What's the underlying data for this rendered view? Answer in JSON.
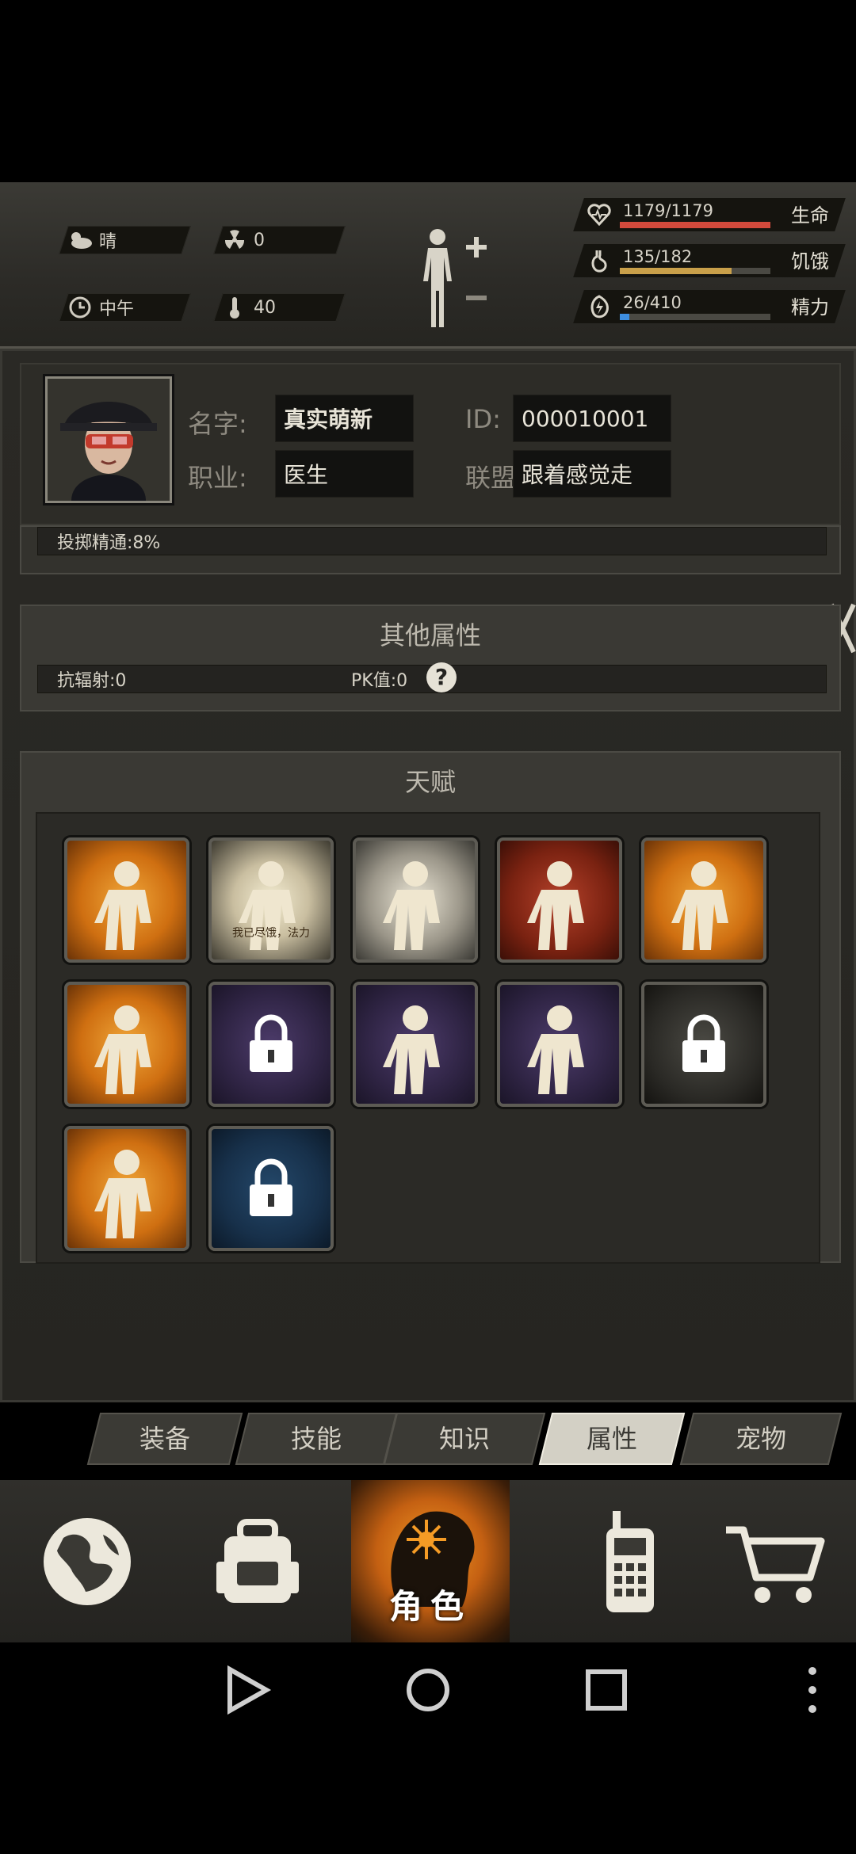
{
  "environment": {
    "weather": "晴",
    "radiation": "0",
    "time_of_day": "中午",
    "temperature": "40"
  },
  "vitals": [
    {
      "value": "1179/1179",
      "label": "生命",
      "ratio": 1.0,
      "color": "#d24a3c",
      "icon": "heart-icon"
    },
    {
      "value": "135/182",
      "label": "饥饿",
      "ratio": 0.742,
      "color": "#c9a04a",
      "icon": "stomach-icon"
    },
    {
      "value": "26/410",
      "label": "精力",
      "ratio": 0.063,
      "color": "#3d8ee0",
      "icon": "energy-icon"
    }
  ],
  "profile": {
    "name_label": "名字:",
    "name_value": "真实萌新",
    "id_label": "ID:",
    "id_value": "000010001",
    "job_label": "职业:",
    "job_value": "医生",
    "alliance_label": "联盟:",
    "alliance_value": "跟着感觉走"
  },
  "partial_row": {
    "text": "投掷精通:8%"
  },
  "other_attributes": {
    "title": "其他属性",
    "radiation_resist": "抗辐射:0",
    "pk_value": "PK值:0",
    "help_glyph": "?"
  },
  "talents": {
    "title": "天赋",
    "items": [
      {
        "name": "porter-talent",
        "style": "orange",
        "locked": false
      },
      {
        "name": "panda-talent",
        "style": "gold",
        "locked": false,
        "caption": "我已尽饿，法力"
      },
      {
        "name": "eater-talent",
        "style": "gray",
        "locked": false
      },
      {
        "name": "fist-talent",
        "style": "red",
        "locked": false
      },
      {
        "name": "strongman-talent",
        "style": "orange",
        "locked": false
      },
      {
        "name": "boxer-talent",
        "style": "orange",
        "locked": false
      },
      {
        "name": "pistol-talent",
        "style": "purple",
        "locked": true
      },
      {
        "name": "rifle-talent",
        "style": "purple",
        "locked": false
      },
      {
        "name": "archer-talent",
        "style": "purple",
        "locked": false
      },
      {
        "name": "shield-talent",
        "style": "dark",
        "locked": true
      },
      {
        "name": "kick-talent",
        "style": "orange",
        "locked": false
      },
      {
        "name": "sneak-talent",
        "style": "blue",
        "locked": true
      }
    ]
  },
  "tabs": [
    {
      "label": "装备",
      "active": false
    },
    {
      "label": "技能",
      "active": false
    },
    {
      "label": "知识",
      "active": false
    },
    {
      "label": "属性",
      "active": true
    },
    {
      "label": "宠物",
      "active": false
    }
  ],
  "bottom_nav": {
    "role_label": "角色",
    "items": [
      "globe-icon",
      "backpack-icon",
      "role-icon",
      "walkie-talkie-icon",
      "cart-icon"
    ]
  }
}
